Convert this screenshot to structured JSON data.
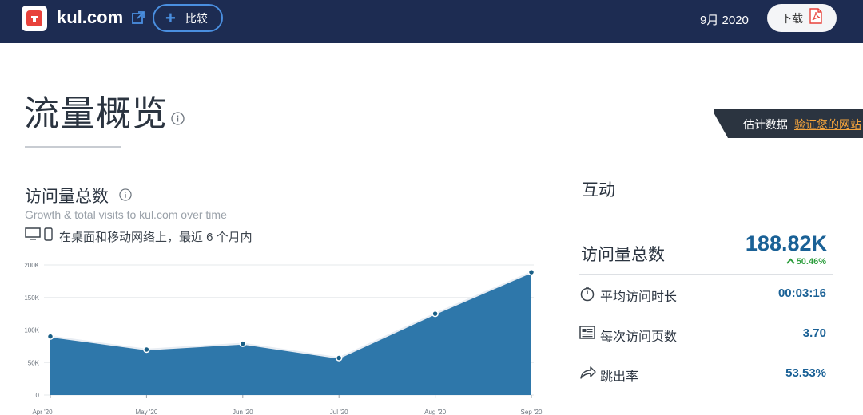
{
  "header": {
    "site_name": "kul.com",
    "compare_label": "比较",
    "date": "9月 2020",
    "download_label": "下载"
  },
  "page": {
    "title": "流量概览"
  },
  "estimate": {
    "text": "估计数据",
    "link": "验证您的网站"
  },
  "visits": {
    "title": "访问量总数",
    "subtitle": "Growth & total visits to kul.com over time",
    "device_text": "在桌面和移动网络上，最近 6 个月内"
  },
  "engagement": {
    "title": "互动",
    "total_label": "访问量总数",
    "total_value": "188.82K",
    "total_change": "50.46%",
    "metrics": [
      {
        "label": "平均访问时长",
        "value": "00:03:16",
        "icon": "stopwatch-icon"
      },
      {
        "label": "每次访问页数",
        "value": "3.70",
        "icon": "pages-icon"
      },
      {
        "label": "跳出率",
        "value": "53.53%",
        "icon": "bounce-arrow-icon"
      }
    ]
  },
  "colors": {
    "header_bg": "#1d2c52",
    "accent": "#1a6196",
    "area_fill": "#2e77aa",
    "positive": "#2e9e3e",
    "link_orange": "#f4a43c"
  },
  "chart_data": {
    "type": "area",
    "categories": [
      "Apr '20",
      "May '20",
      "Jun '20",
      "Jul '20",
      "Aug '20",
      "Sep '20"
    ],
    "values": [
      90000,
      70000,
      79000,
      57000,
      125000,
      188820
    ],
    "yticks": [
      "0",
      "50K",
      "100K",
      "150K",
      "200K"
    ],
    "ylim": [
      0,
      200000
    ],
    "grid": true
  }
}
